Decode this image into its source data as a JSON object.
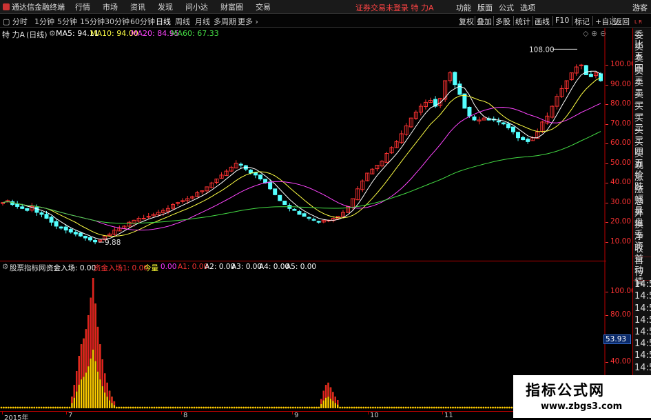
{
  "app": {
    "title": "通达信金融终端",
    "menu": [
      "行情",
      "市场",
      "资讯",
      "发现",
      "问小达",
      "财富圈",
      "交易"
    ],
    "login_note": "证券交易未登录",
    "stock_tag": "特 力A",
    "right_menu": [
      "功能",
      "版面",
      "公式",
      "选项"
    ],
    "guest": "游客"
  },
  "periods": [
    "分时",
    "1分钟",
    "5分钟",
    "15分钟",
    "30分钟",
    "60分钟",
    "日线",
    "周线",
    "月线",
    "多周期",
    "更多"
  ],
  "active_period": "日线",
  "toolbar_right": [
    "复权",
    "叠加",
    "多股",
    "统计",
    "画线",
    "F10",
    "标记",
    "+自选",
    "返回"
  ],
  "price_panel": {
    "name": "特 力A",
    "period_label": "(日线)",
    "ma": [
      {
        "label": "MA5: 94.11",
        "color": "#ffffff"
      },
      {
        "label": "MA10: 94.00",
        "color": "#ffff44"
      },
      {
        "label": "MA20: 84.95",
        "color": "#ff44ff"
      },
      {
        "label": "MA60: 67.33",
        "color": "#44dd44"
      }
    ],
    "high_label": "108.00",
    "low_label": "9.88",
    "axis": [
      "100.00",
      "90.00",
      "80.00",
      "70.00",
      "60.00",
      "50.00",
      "40.00",
      "30.00",
      "20.00",
      "10.00"
    ]
  },
  "indicator_panel": {
    "name": "股票指标网",
    "fields": [
      {
        "label": "资金入场: 0.00",
        "color": "#ffffff"
      },
      {
        "label": "资金入场1: 0.00",
        "color": "#ff3333"
      },
      {
        "label": "今量",
        "color": "#ffff33"
      },
      {
        "label": "0.00",
        "color": "#ff33ff"
      },
      {
        "label": "A1: 0.00",
        "color": "#ff3333"
      },
      {
        "label": "A2: 0.00",
        "color": "#ffffff"
      },
      {
        "label": "A3: 0.00",
        "color": "#ffffff"
      },
      {
        "label": "A4: 0.00",
        "color": "#ffffff"
      },
      {
        "label": "A5: 0.00",
        "color": "#ffffff"
      }
    ],
    "axis": [
      "100.00",
      "80.00",
      "60.00",
      "40.00",
      "20.00"
    ],
    "value_box": "53.93"
  },
  "sidebar": [
    "委比",
    "卖五",
    "卖四",
    "卖三",
    "卖二",
    "卖一",
    "买一",
    "买二",
    "买三",
    "买四",
    "买五",
    "现价",
    "涨跌",
    "涨幅",
    "总量",
    "外盘",
    "换手",
    "净资",
    "收益",
    "自动",
    "行情",
    "14:5",
    "14:5",
    "14:5",
    "14:5",
    "14:5",
    "14:5",
    "14:5",
    "14:5"
  ],
  "sidebar_tags": {
    "top": "L R",
    "sub": "DDE"
  },
  "x_axis": [
    "2015年",
    "7",
    "8",
    "9",
    "10",
    "11"
  ],
  "watermark": {
    "title": "指标公式网",
    "url": "www.zbgs3.com"
  },
  "chart_data": [
    {
      "type": "candlestick",
      "title": "特 力A (日线)",
      "x": [
        "2015年",
        "7",
        "8",
        "9",
        "10",
        "11"
      ],
      "ylim": [
        5,
        112
      ],
      "ticks": [
        100,
        90,
        80,
        70,
        60,
        50,
        40,
        30,
        20,
        10
      ],
      "closes": [
        30,
        31,
        29,
        28,
        27,
        26,
        28,
        25,
        24,
        22,
        20,
        18,
        17,
        16,
        15,
        14,
        13,
        12,
        11,
        10,
        11,
        13,
        14,
        16,
        17,
        18,
        20,
        21,
        22,
        22,
        23,
        24,
        25,
        26,
        27,
        29,
        30,
        31,
        32,
        33,
        35,
        36,
        38,
        40,
        42,
        44,
        46,
        48,
        50,
        49,
        47,
        45,
        44,
        42,
        40,
        37,
        34,
        31,
        29,
        27,
        26,
        24,
        23,
        22,
        21,
        20,
        21,
        21,
        22,
        23,
        25,
        28,
        32,
        37,
        41,
        45,
        47,
        49,
        51,
        55,
        58,
        61,
        65,
        69,
        73,
        76,
        79,
        81,
        82,
        79,
        83,
        92,
        96,
        90,
        85,
        78,
        74,
        72,
        72,
        73,
        72,
        72,
        71,
        70,
        68,
        66,
        63,
        62,
        61,
        63,
        66,
        71,
        74,
        79,
        84,
        88,
        92,
        96,
        99,
        100,
        95,
        94,
        96,
        92
      ],
      "ma_values": {
        "MA5": 94.11,
        "MA10": 94.0,
        "MA20": 84.95,
        "MA60": 67.33
      },
      "high": 108.0,
      "low": 9.88
    },
    {
      "type": "bar",
      "title": "股票指标网",
      "ylim": [
        0,
        115
      ],
      "ticks": [
        100,
        80,
        60,
        40,
        20
      ],
      "values": [
        5,
        5,
        5,
        5,
        5,
        5,
        5,
        5,
        5,
        5,
        5,
        5,
        5,
        5,
        5,
        5,
        5,
        5,
        5,
        5,
        5,
        5,
        5,
        5,
        5,
        5,
        5,
        5,
        5,
        5,
        10,
        20,
        32,
        45,
        55,
        60,
        68,
        80,
        95,
        112,
        90,
        70,
        55,
        42,
        30,
        22,
        15,
        10,
        6,
        5,
        5,
        5,
        5,
        5,
        5,
        5,
        5,
        5,
        5,
        5,
        5,
        5,
        5,
        5,
        5,
        5,
        5,
        5,
        5,
        5,
        5,
        5,
        5,
        5,
        5,
        5,
        5,
        5,
        5,
        5,
        5,
        5,
        5,
        5,
        5,
        5,
        5,
        5,
        5,
        5,
        5,
        5,
        5,
        5,
        5,
        5,
        5,
        5,
        5,
        5,
        5,
        5,
        5,
        5,
        5,
        5,
        5,
        5,
        5,
        5,
        5,
        5,
        5,
        5,
        5,
        5,
        5,
        5,
        5,
        5,
        5,
        5,
        5,
        5,
        5,
        5,
        5,
        5,
        5,
        5,
        5,
        5,
        5,
        5,
        5,
        5,
        8,
        15,
        20,
        22,
        18,
        14,
        10,
        7,
        5,
        5,
        5,
        5,
        5,
        5,
        5,
        5,
        5,
        5,
        5,
        5,
        5,
        5,
        5,
        5,
        5,
        5,
        5,
        5,
        5,
        5,
        5,
        5,
        5,
        5,
        5,
        5,
        5,
        5,
        5,
        5,
        5,
        5,
        5,
        5,
        5,
        5,
        5,
        5,
        5,
        5,
        5,
        5,
        5,
        5,
        5,
        5,
        5,
        5,
        5,
        5,
        5,
        5,
        5,
        5,
        5,
        5,
        5,
        5,
        5,
        5,
        5,
        5,
        5,
        5,
        5,
        5,
        5,
        5,
        5,
        5,
        5,
        5,
        5,
        5,
        5,
        5,
        5,
        5,
        5,
        5,
        5,
        5,
        5,
        5,
        5,
        5,
        5,
        5,
        5,
        5,
        5,
        5,
        5,
        5,
        5,
        5,
        5,
        5,
        5,
        5,
        5,
        5,
        5,
        5,
        5,
        5,
        5,
        5,
        5,
        5,
        5
      ],
      "value_box": 53.93
    }
  ]
}
